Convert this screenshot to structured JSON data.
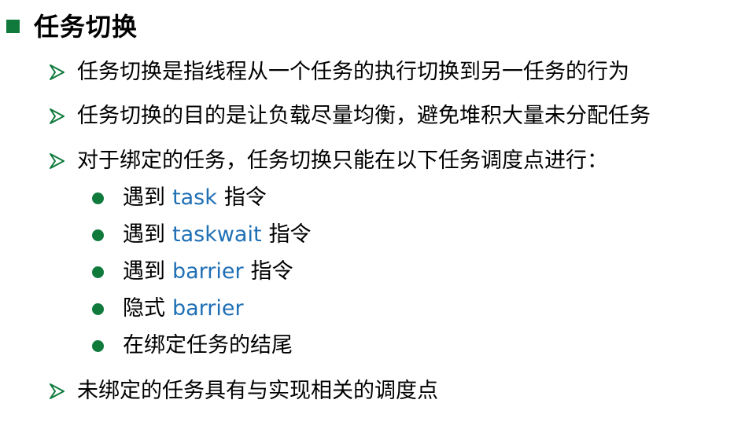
{
  "title": "任务切换",
  "colors": {
    "accent_green": "#0f7a3c",
    "keyword_blue": "#1f6fb5",
    "text": "#000000"
  },
  "bullets": [
    {
      "text": "任务切换是指线程从一个任务的执行切换到另一任务的行为"
    },
    {
      "text": "任务切换的目的是让负载尽量均衡，避免堆积大量未分配任务"
    },
    {
      "text": "对于绑定的任务，任务切换只能在以下任务调度点进行："
    }
  ],
  "sub_bullets": [
    {
      "prefix": "遇到",
      "keyword": "task",
      "suffix": "指令"
    },
    {
      "prefix": "遇到",
      "keyword": "taskwait",
      "suffix": "指令"
    },
    {
      "prefix": "遇到",
      "keyword": "barrier",
      "suffix": "指令"
    },
    {
      "prefix": "隐式",
      "keyword": "barrier",
      "suffix": ""
    },
    {
      "prefix": "在绑定任务的结尾",
      "keyword": "",
      "suffix": ""
    }
  ],
  "last_bullet": {
    "text": "未绑定的任务具有与实现相关的调度点"
  },
  "icons": {
    "title_marker": "square-bullet-icon",
    "level1_marker": "arrow-bullet-icon",
    "level2_marker": "dot-bullet-icon"
  }
}
